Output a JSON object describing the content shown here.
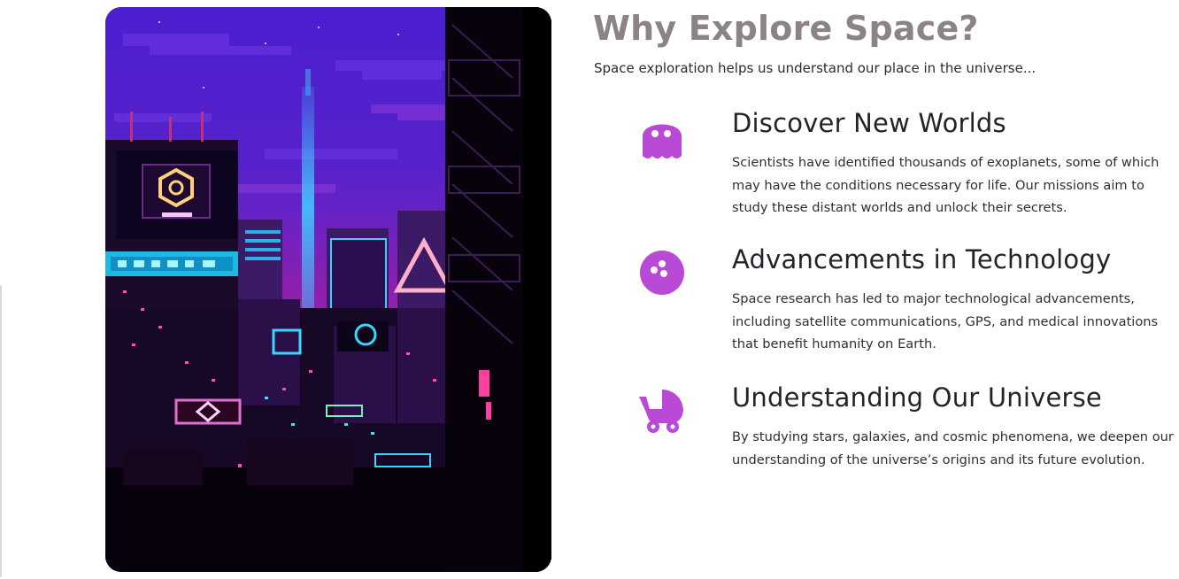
{
  "colors": {
    "heading": "#8c8484",
    "icon_accent": "#b94ad6",
    "text": "#2f2f33"
  },
  "section": {
    "title": "Why Explore Space?",
    "intro": "Space exploration helps us understand our place in the universe..."
  },
  "illustration": {
    "subject": "pixel-art neon cyberpunk city at night"
  },
  "features": [
    {
      "icon": "ghost-icon",
      "title": "Discover New Worlds",
      "text": "Scientists have identified thousands of exoplanets, some of which may have the conditions necessary for life. Our missions aim to study these distant worlds and unlock their secrets."
    },
    {
      "icon": "bowling-ball-icon",
      "title": "Advancements in Technology",
      "text": "Space research has led to major technological advancements, including satellite communications, GPS, and medical innovations that benefit humanity on Earth."
    },
    {
      "icon": "baby-carriage-icon",
      "title": "Understanding Our Universe",
      "text": "By studying stars, galaxies, and cosmic phenomena, we deepen our understanding of the universe’s origins and its future evolution."
    }
  ]
}
